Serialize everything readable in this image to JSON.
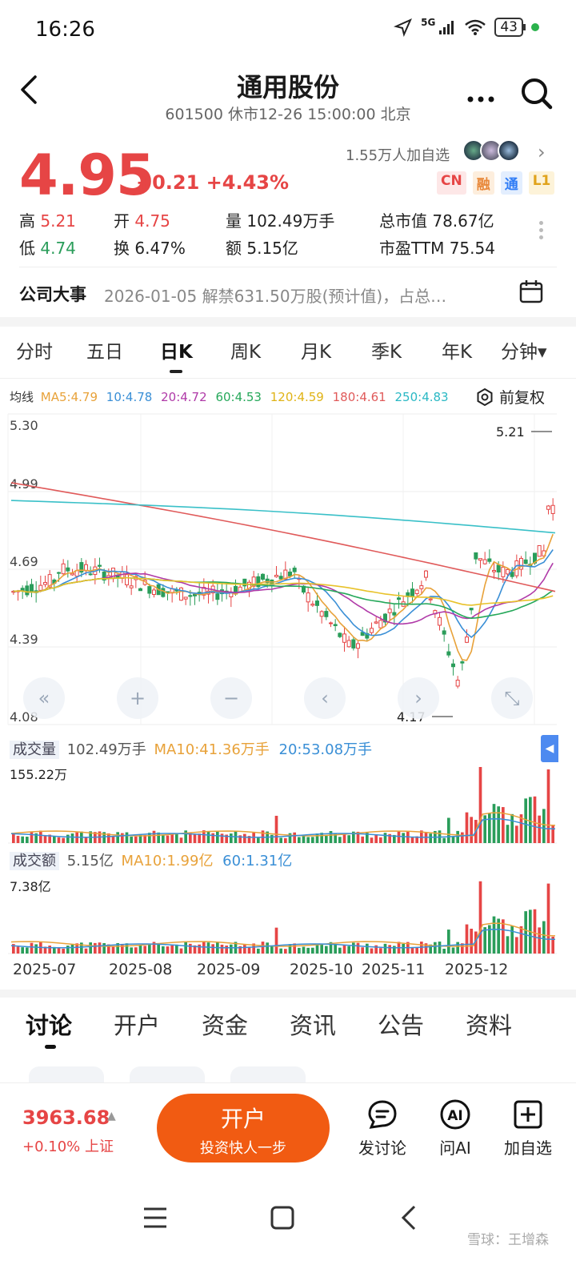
{
  "status_bar": {
    "time": "16:26",
    "network": "5G",
    "battery": "43"
  },
  "header": {
    "title": "通用股份",
    "subtitle": "601500 休市12-26 15:00:00 北京"
  },
  "quote": {
    "price": "4.95",
    "change": "+0.21 +4.43%",
    "followers": "1.55万人加自选",
    "tags": [
      "CN",
      "融",
      "通",
      "L1"
    ],
    "high_label": "高",
    "high": "5.21",
    "open_label": "开",
    "open": "4.75",
    "volume_label": "量",
    "volume": "102.49万手",
    "mcap_label": "总市值",
    "mcap": "78.67亿",
    "low_label": "低",
    "low": "4.74",
    "turnover_label": "换",
    "turnover": "6.47%",
    "amount_label": "额",
    "amount": "5.15亿",
    "pe_label": "市盈TTM",
    "pe": "75.54"
  },
  "event": {
    "title": "公司大事",
    "text": "2026-01-05 解禁631.50万股(预计值)，占总…"
  },
  "period_tabs": [
    "分时",
    "五日",
    "日K",
    "周K",
    "月K",
    "季K",
    "年K",
    "分钟▾"
  ],
  "ma": {
    "label": "均线",
    "ma5": "MA5:4.79",
    "ma10": "10:4.78",
    "ma20": "20:4.72",
    "ma60": "60:4.53",
    "ma120": "120:4.59",
    "ma180": "180:4.61",
    "ma250": "250:4.83",
    "fuquan": "前复权"
  },
  "colors": {
    "up": "#e64545",
    "down": "#2a9d5a",
    "ma5": "#e8a23a",
    "ma10": "#3a8fd6",
    "ma20": "#b03aa8",
    "ma60": "#26a85a",
    "ma120": "#e8c22a",
    "ma180": "#e05a5a",
    "ma250": "#3ac0c8"
  },
  "chart_labels": {
    "y_ticks": [
      "5.30",
      "4.99",
      "4.69",
      "4.39",
      "4.08"
    ],
    "max_label": "5.21",
    "min_label": "4.17",
    "vol_title": "成交量",
    "vol_value": "102.49万手",
    "vol_ma10": "MA10:41.36万手",
    "vol_ma20": "20:53.08万手",
    "vol_max": "155.22万",
    "amt_title": "成交额",
    "amt_value": "5.15亿",
    "amt_ma10": "MA10:1.99亿",
    "amt_ma60": "60:1.31亿",
    "amt_max": "7.38亿",
    "dates": [
      "2025-07",
      "2025-08",
      "2025-09",
      "2025-10",
      "2025-11",
      "2025-12"
    ]
  },
  "bottom_tabs": [
    "讨论",
    "开户",
    "资金",
    "资讯",
    "公告",
    "资料"
  ],
  "bottom_bar": {
    "index_price": "3963.68",
    "index_change": "+0.10% 上证",
    "open_title": "开户",
    "open_sub": "投资快人一步",
    "discuss": "发讨论",
    "ask_ai": "问AI",
    "add_watch": "加自选"
  },
  "watermark": "雪球：王增森",
  "chart_data": {
    "type": "candlestick",
    "x_range": [
      "2025-07",
      "2025-12"
    ],
    "y_range": [
      4.08,
      5.3
    ],
    "highlights": {
      "max": 5.21,
      "min": 4.17,
      "last_close": 4.95
    },
    "series": [
      {
        "name": "MA5",
        "value": 4.79
      },
      {
        "name": "10",
        "value": 4.78
      },
      {
        "name": "20",
        "value": 4.72
      },
      {
        "name": "60",
        "value": 4.53
      },
      {
        "name": "120",
        "value": 4.59
      },
      {
        "name": "180",
        "value": 4.61
      },
      {
        "name": "250",
        "value": 4.83
      }
    ]
  }
}
